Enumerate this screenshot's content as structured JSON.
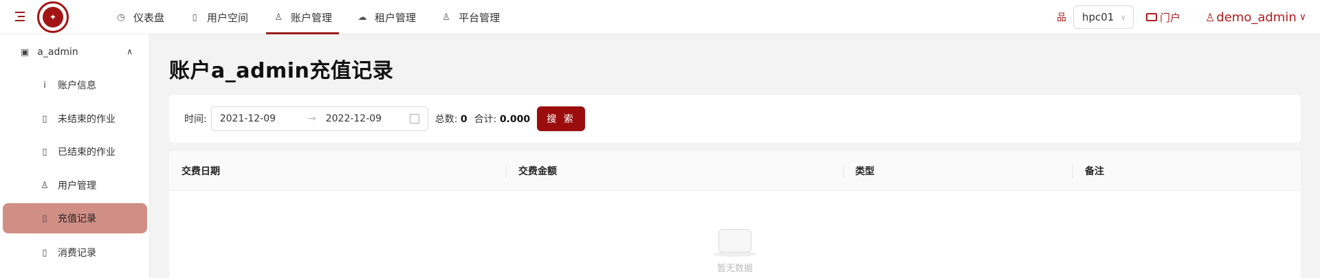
{
  "header": {
    "nav": [
      {
        "label": "仪表盘",
        "icon": "dashboard-icon"
      },
      {
        "label": "用户空间",
        "icon": "book-icon"
      },
      {
        "label": "账户管理",
        "icon": "user-icon",
        "active": true
      },
      {
        "label": "租户管理",
        "icon": "cloud-icon"
      },
      {
        "label": "平台管理",
        "icon": "user-icon"
      }
    ],
    "cluster": "hpc01",
    "portal": "门户",
    "user": "demo_admin"
  },
  "sidebar": {
    "group": "a_admin",
    "items": [
      {
        "label": "账户信息",
        "icon": "info-icon"
      },
      {
        "label": "未结束的作业",
        "icon": "book-icon"
      },
      {
        "label": "已结束的作业",
        "icon": "book-icon"
      },
      {
        "label": "用户管理",
        "icon": "user-icon"
      },
      {
        "label": "充值记录",
        "icon": "book-icon",
        "active": true
      },
      {
        "label": "消费记录",
        "icon": "book-icon"
      }
    ]
  },
  "main": {
    "title": "账户a_admin充值记录",
    "filter": {
      "time_label": "时间:",
      "start_date": "2021-12-09",
      "end_date": "2022-12-09",
      "total_label": "总数:",
      "total_value": "0",
      "sum_label": "合计:",
      "sum_value": "0.000",
      "search_label": "搜 索"
    },
    "table": {
      "columns": [
        "交费日期",
        "交费金额",
        "类型",
        "备注"
      ],
      "empty_text": "暂无数据"
    }
  },
  "colors": {
    "accent": "#9b0d0d",
    "active_item": "#d08e85"
  }
}
